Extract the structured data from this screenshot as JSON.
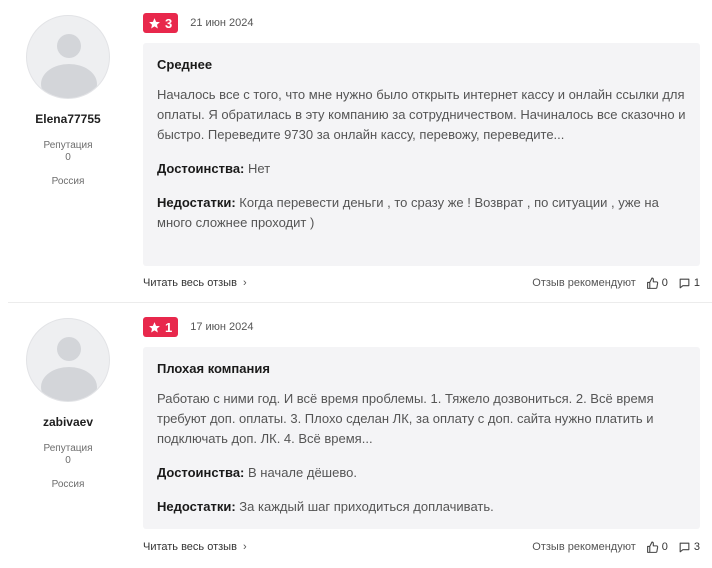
{
  "reviews": [
    {
      "author": "Elena77755",
      "reputation_label": "Репутация",
      "reputation_value": "0",
      "country": "Россия",
      "rating": "3",
      "date": "21 июн 2024",
      "title": "Среднее",
      "text": "Началось все с того, что мне нужно было открыть интернет кассу и онлайн ссылки для оплаты. Я обратилась в эту компанию за сотрудничеством. Начиналось все сказочно и быстро. Переведите 9730 за онлайн кассу, перевожу, переведите...",
      "pros_label": "Достоинства:",
      "pros": "Нет",
      "cons_label": "Недостатки:",
      "cons": "Когда перевести деньги , то сразу же ! Возврат , по ситуации , уже на много сложнее проходит )",
      "read_more": "Читать весь отзыв",
      "recommend": "Отзыв рекомендуют",
      "likes": "0",
      "comments": "1"
    },
    {
      "author": "zabivaev",
      "reputation_label": "Репутация",
      "reputation_value": "0",
      "country": "Россия",
      "rating": "1",
      "date": "17 июн 2024",
      "title": "Плохая компания",
      "text": "Работаю с ними год. И всё время проблемы. 1. Тяжело дозвониться. 2. Всё время требуют доп. оплаты. 3. Плохо сделан ЛК, за оплату с доп. сайта нужно платить и подключать доп. ЛК. 4. Всё время...",
      "pros_label": "Достоинства:",
      "pros": "В начале дёшево.",
      "cons_label": "Недостатки:",
      "cons": "За каждый шаг приходиться доплачивать.",
      "read_more": "Читать весь отзыв",
      "recommend": "Отзыв рекомендуют",
      "likes": "0",
      "comments": "3"
    }
  ],
  "colors": {
    "badge": "#e8284c",
    "card_bg": "#f4f4f6"
  },
  "icons": {
    "star": "star-icon",
    "thumb": "thumbs-up-icon",
    "comment": "comment-icon",
    "chevron": "chevron-right-icon"
  }
}
